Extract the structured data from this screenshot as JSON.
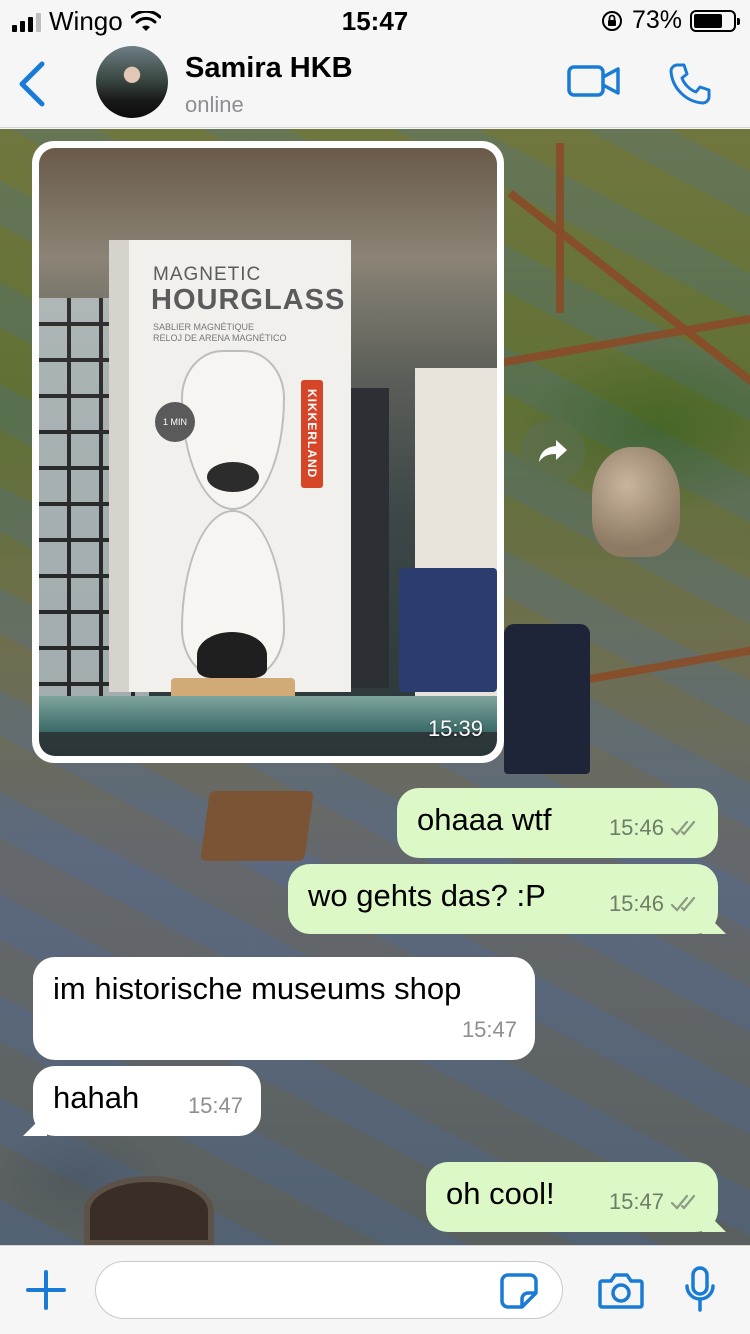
{
  "status_bar": {
    "carrier": "Wingo",
    "time": "15:47",
    "battery_percent": "73%",
    "battery_level": 0.73
  },
  "header": {
    "contact_name": "Samira HKB",
    "contact_status": "online",
    "icons": [
      "chevron-left-icon",
      "avatar",
      "video-camera-icon",
      "phone-icon"
    ],
    "accent_color": "#1a7bd6"
  },
  "chat": {
    "image_message": {
      "time": "15:39",
      "box_text": {
        "line1": "MAGNETIC",
        "line2": "HOURGLASS",
        "sub1": "SABLIER MAGNÉTIQUE",
        "sub2": "RELOJ DE ARENA MAGNÉTICO",
        "brand": "KIKKERLAND",
        "badge": "1 MIN"
      }
    },
    "messages": [
      {
        "direction": "out",
        "text": "ohaaa wtf",
        "time": "15:46",
        "status": "read"
      },
      {
        "direction": "out",
        "text": "wo gehts das? :P",
        "time": "15:46",
        "status": "read"
      },
      {
        "direction": "in",
        "text": "im historische museums shop",
        "time": "15:47"
      },
      {
        "direction": "in",
        "text": "hahah",
        "time": "15:47"
      },
      {
        "direction": "out",
        "text": "oh cool!",
        "time": "15:47",
        "status": "read"
      }
    ],
    "colors": {
      "outgoing_bubble": "#dcf8c6",
      "incoming_bubble": "#ffffff"
    }
  },
  "input_bar": {
    "placeholder": "",
    "icons": [
      "plus-icon",
      "sticker-icon",
      "camera-icon",
      "microphone-icon"
    ]
  }
}
